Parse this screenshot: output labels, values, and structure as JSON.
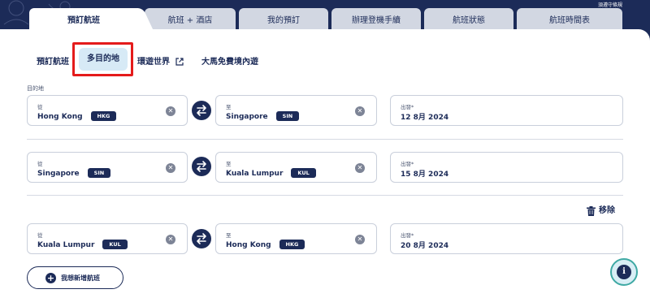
{
  "header": {
    "notice": "須遵守條規"
  },
  "tabs": [
    {
      "label": "預訂航班"
    },
    {
      "label": "航班 + 酒店"
    },
    {
      "label": "我的預訂"
    },
    {
      "label": "辦理登機手續"
    },
    {
      "label": "航班狀態"
    },
    {
      "label": "航班時間表"
    }
  ],
  "subtabs": [
    {
      "label": "預訂航班"
    },
    {
      "label": "多目的地"
    },
    {
      "label": "環遊世界"
    },
    {
      "label": "大馬免費境內遊"
    }
  ],
  "section_label": "目的地",
  "legs": [
    {
      "from_label": "從",
      "from_city": "Hong Kong",
      "from_code": "HKG",
      "to_label": "至",
      "to_city": "Singapore",
      "to_code": "SIN",
      "date_label": "出發*",
      "date": "12 8月 2024"
    },
    {
      "from_label": "從",
      "from_city": "Singapore",
      "from_code": "SIN",
      "to_label": "至",
      "to_city": "Kuala Lumpur",
      "to_code": "KUL",
      "date_label": "出發*",
      "date": "15 8月 2024"
    },
    {
      "from_label": "從",
      "from_city": "Kuala Lumpur",
      "from_code": "KUL",
      "to_label": "至",
      "to_city": "Hong Kong",
      "to_code": "HKG",
      "date_label": "出發*",
      "date": "20 8月 2024"
    }
  ],
  "remove_label": "移除",
  "add_flight_label": "我想新增航班",
  "icons": {
    "clear": "clear-icon",
    "swap": "swap-icon",
    "trash": "trash-icon",
    "plus": "plus-icon",
    "info": "info-icon",
    "external": "external-link-icon"
  },
  "colors": {
    "navy": "#1c2b58",
    "highlight": "#e41b1b",
    "active_subtab": "#d7eaf6",
    "teal": "#3fa9a4"
  }
}
